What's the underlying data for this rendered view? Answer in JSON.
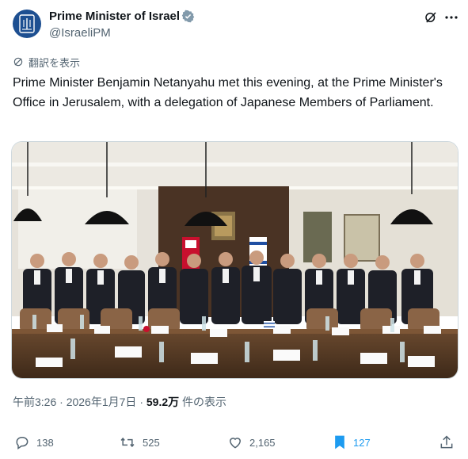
{
  "author": {
    "name": "Prime Minister of Israel",
    "handle": "@IsraeliPM"
  },
  "translate": {
    "label": "翻訳を表示"
  },
  "post": {
    "text": "Prime Minister Benjamin Netanyahu met this evening, at the Prime Minister's Office in Jerusalem, with a delegation of Japanese Members of Parliament."
  },
  "meta": {
    "time": "午前3:26",
    "separator": "·",
    "date": "2026年1月7日",
    "views_count": "59.2万",
    "views_label": "件の表示"
  },
  "actions": {
    "replies": "138",
    "reposts": "525",
    "likes": "2,165",
    "bookmarks": "127"
  },
  "colors": {
    "text": "#0f1419",
    "muted": "#536471",
    "accent": "#1d9bf0",
    "verified": "#829aab"
  },
  "icons": {
    "verified": "verified-badge-icon",
    "grok": "grok-icon",
    "more": "more-icon",
    "translate": "translate-icon",
    "reply": "reply-icon",
    "repost": "repost-icon",
    "like": "like-icon",
    "bookmark": "bookmark-icon",
    "share": "share-icon"
  }
}
